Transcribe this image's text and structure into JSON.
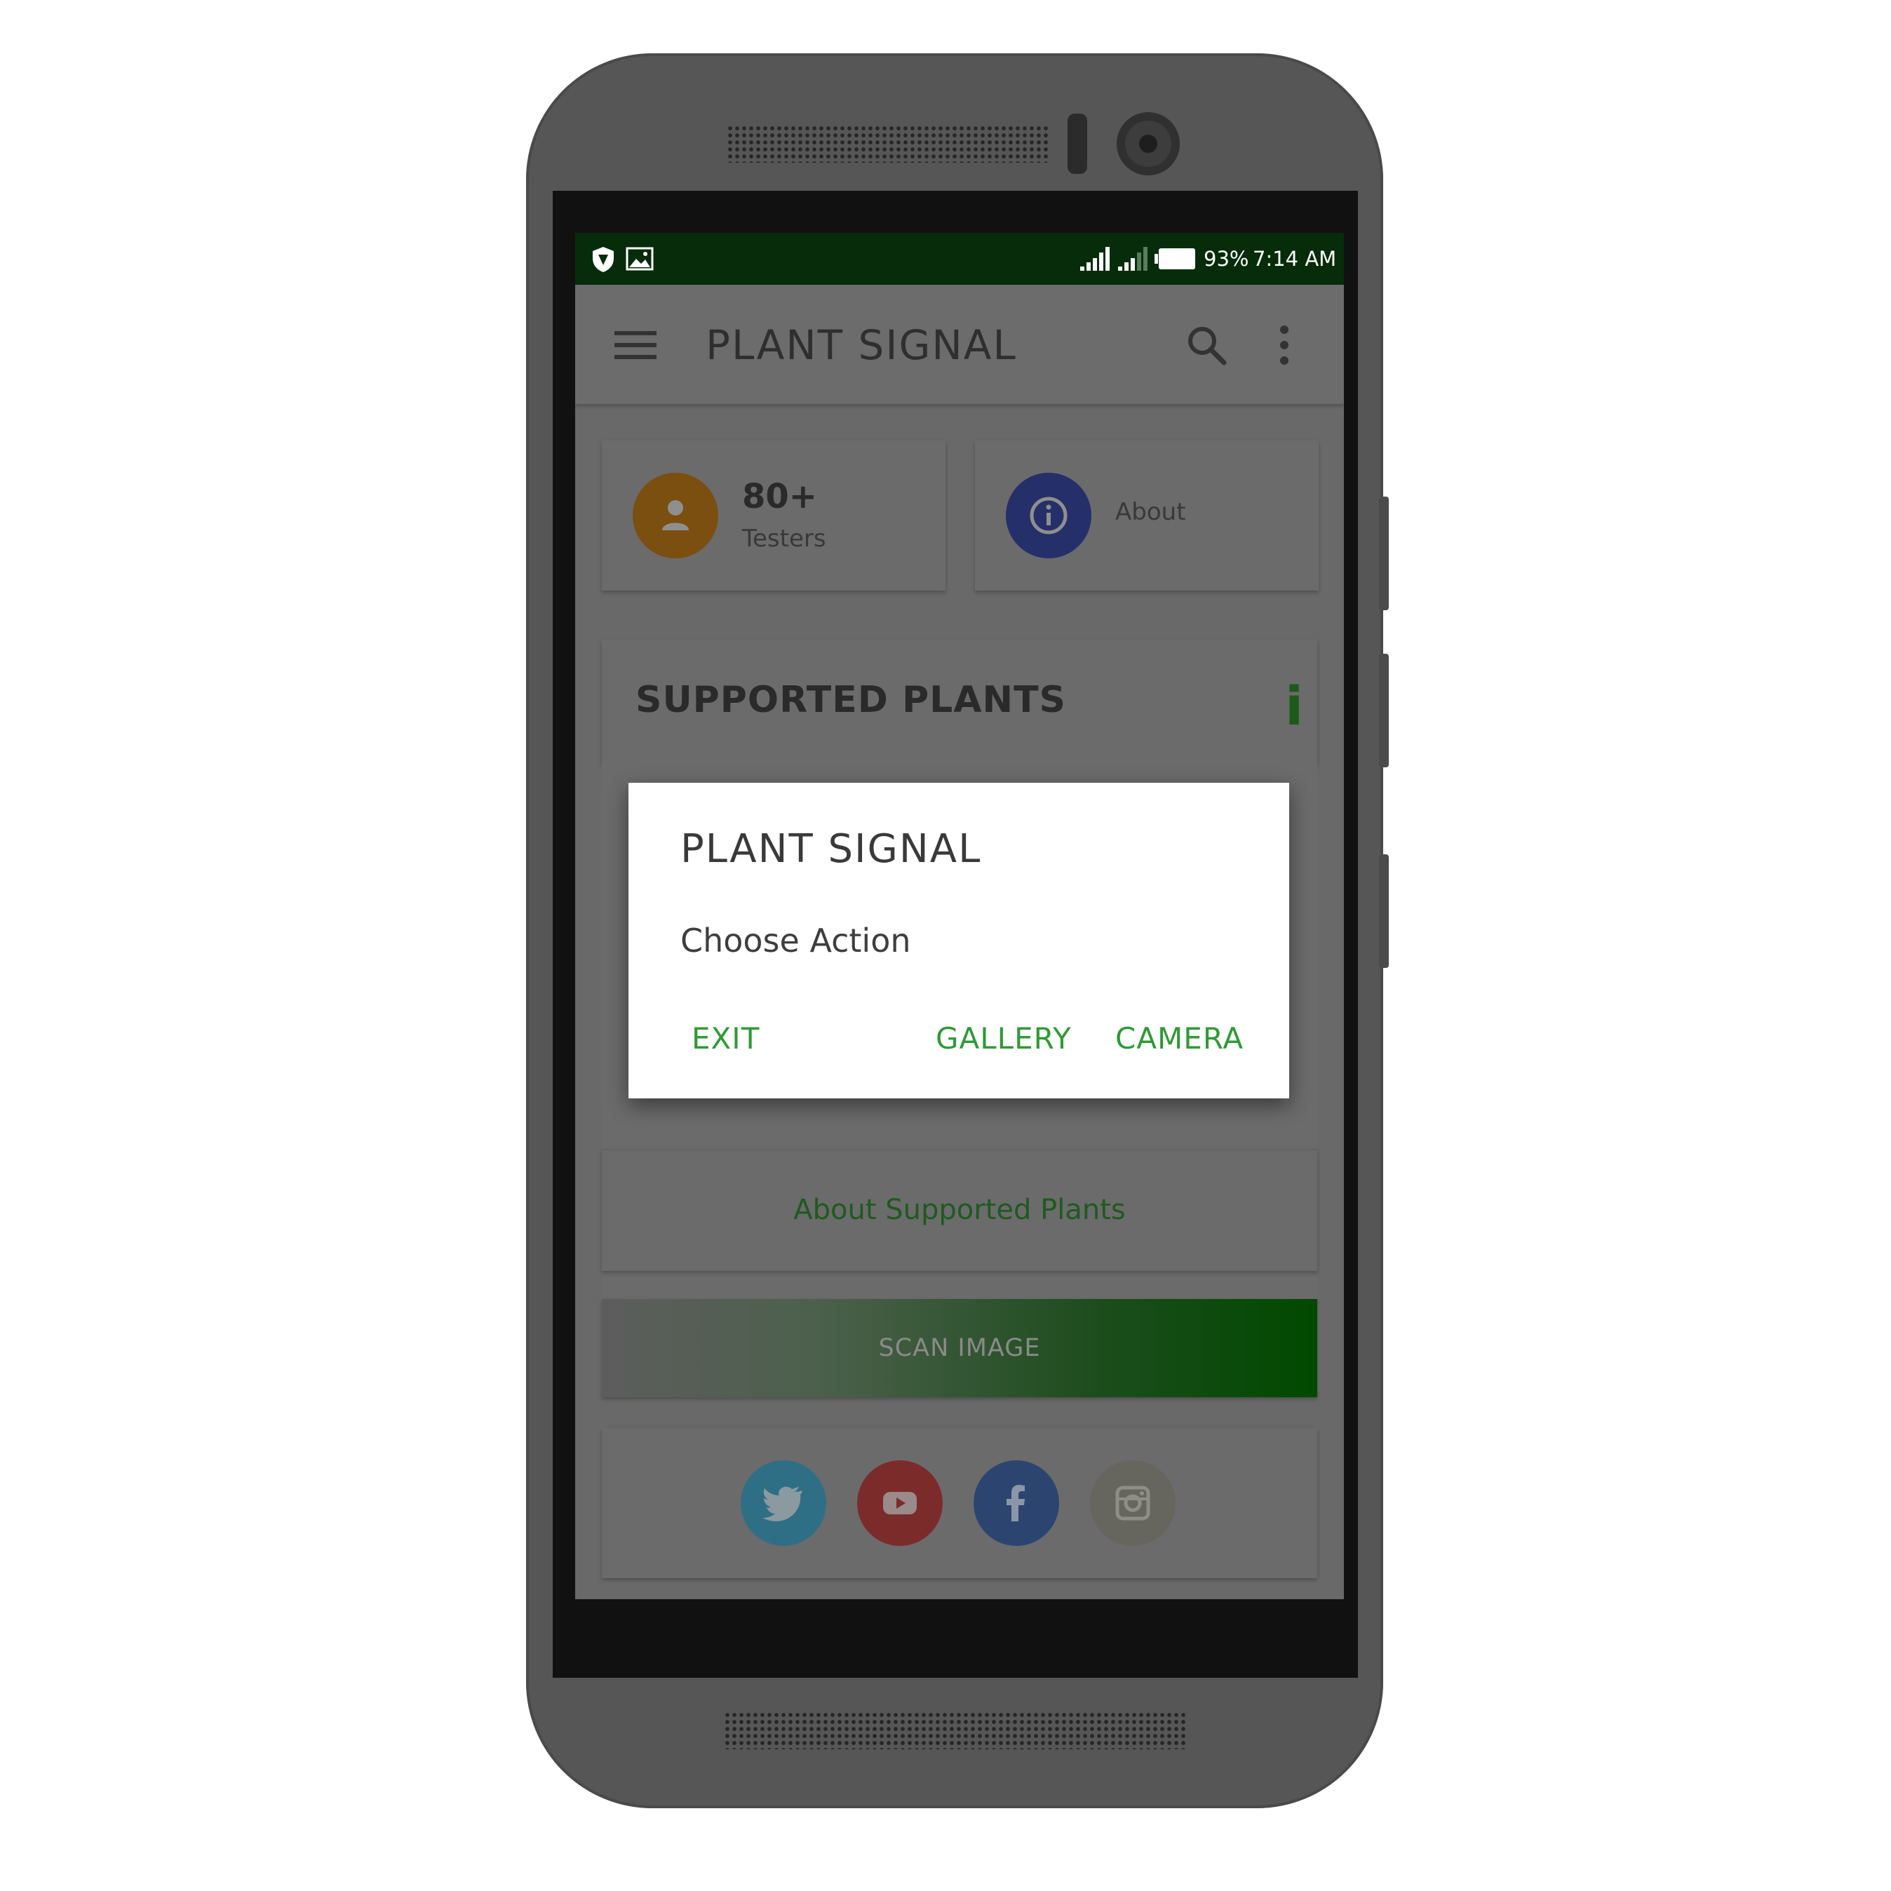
{
  "status_bar": {
    "battery_percent": "93%",
    "time": "7:14 AM",
    "left_icons": [
      "shield-icon",
      "image-icon"
    ],
    "right_icons": [
      "signal-icon",
      "signal-icon",
      "battery-icon"
    ]
  },
  "app_bar": {
    "title": "PLANT SIGNAL",
    "icons": [
      "menu-icon",
      "search-icon",
      "more-vert-icon"
    ]
  },
  "stats": {
    "testers_count": "80+",
    "testers_label": "Testers",
    "about_label": "About"
  },
  "supported_plants": {
    "title": "SUPPORTED PLANTS",
    "info_glyph": "i",
    "link_label": "About Supported Plants"
  },
  "scan_button": {
    "label": "SCAN IMAGE"
  },
  "social": [
    "twitter-icon",
    "youtube-icon",
    "facebook-icon",
    "instagram-icon"
  ],
  "dialog": {
    "title": "PLANT SIGNAL",
    "message": "Choose Action",
    "exit_label": "EXIT",
    "gallery_label": "GALLERY",
    "camera_label": "CAMERA"
  },
  "colors": {
    "status_bar": "#062c0a",
    "accent_green": "#2f9a36",
    "testers_avatar": "#7a4f0f",
    "about_avatar": "#25306a",
    "twitter": "#2f6f86",
    "youtube": "#7c2b2b",
    "facebook": "#2c4570",
    "instagram": "#66665e"
  }
}
